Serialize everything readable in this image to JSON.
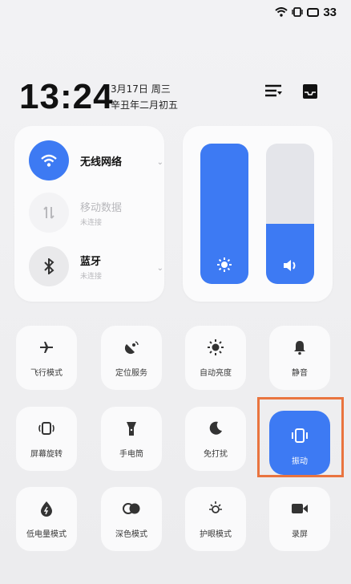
{
  "status_bar": {
    "battery": "33",
    "icons": [
      "wifi-icon",
      "vibrate-icon",
      "battery-icon"
    ]
  },
  "header": {
    "time": "13:24",
    "date_line1": "3月17日 周三",
    "date_line2": "辛丑年二月初五",
    "icons": [
      "edit-list-icon",
      "inbox-icon"
    ]
  },
  "connectivity": {
    "wifi": {
      "title": "无线网络",
      "state": "on"
    },
    "mobile": {
      "title": "移动数据",
      "subtitle": "未连接",
      "state": "off"
    },
    "bluetooth": {
      "title": "蓝牙",
      "subtitle": "未连接",
      "state": "off"
    }
  },
  "sliders": {
    "brightness": {
      "level": 1.0,
      "icon": "brightness-icon"
    },
    "volume": {
      "level": 0.43,
      "icon": "volume-icon"
    }
  },
  "tiles": [
    {
      "label": "飞行模式",
      "icon": "airplane-icon",
      "active": false
    },
    {
      "label": "定位服务",
      "icon": "location-icon",
      "active": false
    },
    {
      "label": "自动亮度",
      "icon": "auto-brightness-icon",
      "active": false
    },
    {
      "label": "静音",
      "icon": "bell-icon",
      "active": false
    },
    {
      "label": "屏幕旋转",
      "icon": "rotate-icon",
      "active": false
    },
    {
      "label": "手电筒",
      "icon": "flashlight-icon",
      "active": false
    },
    {
      "label": "免打扰",
      "icon": "moon-icon",
      "active": false
    },
    {
      "label": "振动",
      "icon": "vibrate-icon",
      "active": true
    },
    {
      "label": "低电量模式",
      "icon": "low-power-icon",
      "active": false
    },
    {
      "label": "深色模式",
      "icon": "dark-mode-icon",
      "active": false
    },
    {
      "label": "护眼模式",
      "icon": "eye-care-icon",
      "active": false
    },
    {
      "label": "录屏",
      "icon": "screen-record-icon",
      "active": false
    }
  ],
  "colors": {
    "accent": "#3d7af3",
    "highlight": "#e9743f",
    "card": "#fbfbfc"
  }
}
